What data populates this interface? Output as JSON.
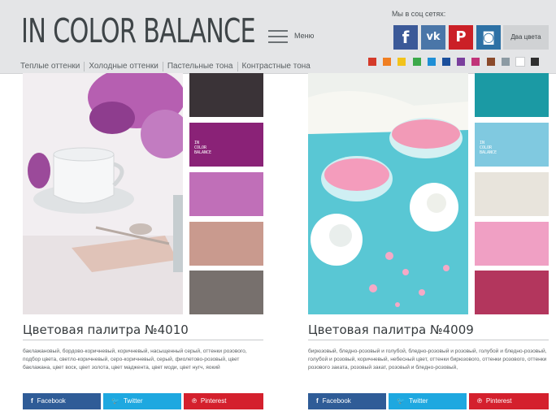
{
  "header": {
    "logo": "IN COLOR BALANCE",
    "menu_label": "Меню",
    "nav": [
      "Теплые оттенки",
      "Холодные оттенки",
      "Пастельные тона",
      "Контрастные тона"
    ],
    "social_title": "Мы в соц сетях:",
    "social": [
      {
        "name": "facebook",
        "glyph": "f",
        "color": "#3b5998"
      },
      {
        "name": "vk",
        "glyph": "vk",
        "color": "#4a76a8"
      },
      {
        "name": "pinterest",
        "glyph": "P",
        "color": "#cb2027"
      },
      {
        "name": "instagram",
        "glyph": "◙",
        "color": "#2d71a5"
      }
    ],
    "two_colors_label": "Два цвета",
    "color_swatches": [
      "#d43a2a",
      "#f07f22",
      "#f2c31b",
      "#3ca94a",
      "#1f8fd6",
      "#1b4f9c",
      "#7a3f9d",
      "#c13479",
      "#8b4a2b",
      "#8c9aa3",
      "#ffffff",
      "#2f2f2f"
    ]
  },
  "cards": [
    {
      "title": "Цветовая палитра №4010",
      "palette": [
        "#3a3337",
        "#8a2277",
        "#c06fb8",
        "#c99a8e",
        "#77706d"
      ],
      "palette_text": "IN\nCOLOR\nBALANCE",
      "description": "баклажановый, бордово-коричневый, коричневый, насыщенный серый, оттенки розового, подбор цвета, светло-коричневый, серо-коричневый, серый, фиолетово-розовый, цвет баклажана, цвет воск, цвет золота, цвет маджента, цвет моди, цвет нугч, яокий"
    },
    {
      "title": "Цветовая палитра №4009",
      "palette": [
        "#1b9aa4",
        "#80c9e0",
        "#e8e4dc",
        "#f0a0c4",
        "#b3365d"
      ],
      "palette_text": "IN\nCOLOR\nBALANCE",
      "description": "бирюзовый, бледно-розовый и голубой, бледно-розовый и розовый, голубой и бледно-розовый, голубой и розовый, коричневый, небесный цвет, оттенки бирюзового, оттенки розового, оттенки розового заката, розовый закат, розовый и бледно-розовый,"
    }
  ],
  "share_buttons": [
    {
      "label": "Facebook",
      "icon": "f",
      "color": "#2f5c97"
    },
    {
      "label": "Twitter",
      "icon": "🐦",
      "color": "#1ea8e0"
    },
    {
      "label": "Pinterest",
      "icon": "℗",
      "color": "#d4202d"
    }
  ]
}
